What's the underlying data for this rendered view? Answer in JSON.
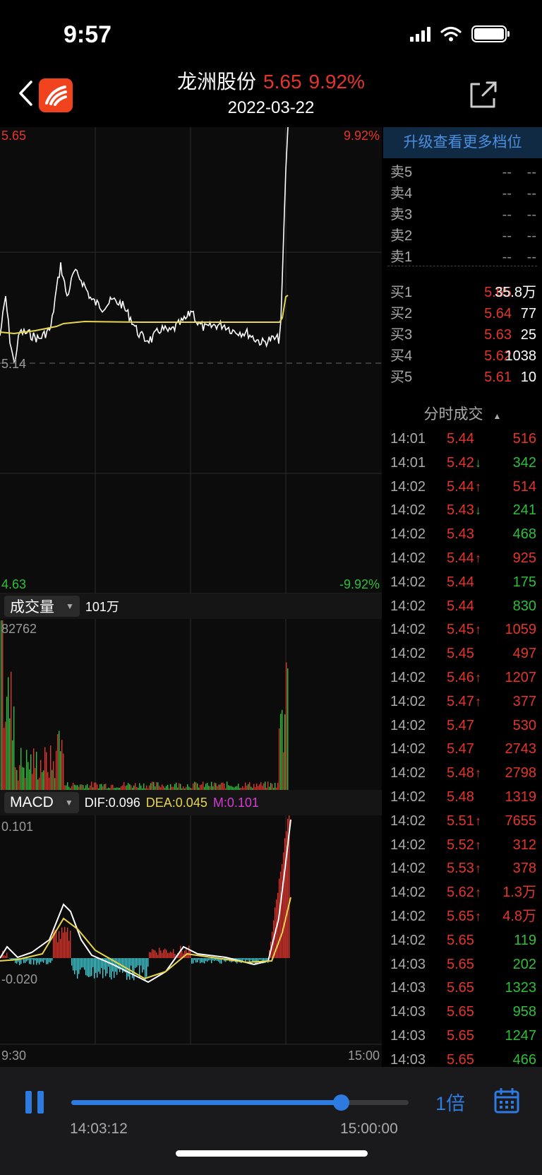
{
  "status_bar": {
    "time": "9:57"
  },
  "header": {
    "stock_name": "龙洲股份",
    "price": "5.65",
    "change_pct": "9.92%",
    "date": "2022-03-22"
  },
  "price_chart": {
    "high_price": "5.65",
    "high_pct": "9.92%",
    "low_price": "4.63",
    "low_pct": "-9.92%",
    "base_price": "5.14"
  },
  "volume_panel": {
    "indicator": "成交量",
    "total": "101万",
    "max_label": "82762"
  },
  "macd_panel": {
    "indicator": "MACD",
    "dif": "DIF:0.096",
    "dea": "DEA:0.045",
    "m": "M:0.101",
    "max_label": "0.101",
    "min_label": "-0.020",
    "time_start": "9:30",
    "time_end": "15:00"
  },
  "order_book": {
    "upgrade_label": "升级查看更多档位",
    "sells": [
      {
        "label": "卖5",
        "price": "--",
        "volume": "--"
      },
      {
        "label": "卖4",
        "price": "--",
        "volume": "--"
      },
      {
        "label": "卖3",
        "price": "--",
        "volume": "--"
      },
      {
        "label": "卖2",
        "price": "--",
        "volume": "--"
      },
      {
        "label": "卖1",
        "price": "--",
        "volume": "--"
      }
    ],
    "buys": [
      {
        "label": "买1",
        "price": "5.65",
        "volume": "35.8万"
      },
      {
        "label": "买2",
        "price": "5.64",
        "volume": "77"
      },
      {
        "label": "买3",
        "price": "5.63",
        "volume": "25"
      },
      {
        "label": "买4",
        "price": "5.62",
        "volume": "1038"
      },
      {
        "label": "买5",
        "price": "5.61",
        "volume": "10"
      }
    ]
  },
  "ticks": {
    "title": "分时成交",
    "rows": [
      {
        "time": "14:01",
        "price": "5.44",
        "arrow": "",
        "volume": "516",
        "color": "red"
      },
      {
        "time": "14:01",
        "price": "5.42",
        "arrow": "↓",
        "volume": "342",
        "color": "green"
      },
      {
        "time": "14:02",
        "price": "5.44",
        "arrow": "↑",
        "volume": "514",
        "color": "red"
      },
      {
        "time": "14:02",
        "price": "5.43",
        "arrow": "↓",
        "volume": "241",
        "color": "green"
      },
      {
        "time": "14:02",
        "price": "5.43",
        "arrow": "",
        "volume": "468",
        "color": "green"
      },
      {
        "time": "14:02",
        "price": "5.44",
        "arrow": "↑",
        "volume": "925",
        "color": "red"
      },
      {
        "time": "14:02",
        "price": "5.44",
        "arrow": "",
        "volume": "175",
        "color": "green"
      },
      {
        "time": "14:02",
        "price": "5.44",
        "arrow": "",
        "volume": "830",
        "color": "green"
      },
      {
        "time": "14:02",
        "price": "5.45",
        "arrow": "↑",
        "volume": "1059",
        "color": "red"
      },
      {
        "time": "14:02",
        "price": "5.45",
        "arrow": "",
        "volume": "497",
        "color": "red"
      },
      {
        "time": "14:02",
        "price": "5.46",
        "arrow": "↑",
        "volume": "1207",
        "color": "red"
      },
      {
        "time": "14:02",
        "price": "5.47",
        "arrow": "↑",
        "volume": "377",
        "color": "red"
      },
      {
        "time": "14:02",
        "price": "5.47",
        "arrow": "",
        "volume": "530",
        "color": "red"
      },
      {
        "time": "14:02",
        "price": "5.47",
        "arrow": "",
        "volume": "2743",
        "color": "red"
      },
      {
        "time": "14:02",
        "price": "5.48",
        "arrow": "↑",
        "volume": "2798",
        "color": "red"
      },
      {
        "time": "14:02",
        "price": "5.48",
        "arrow": "",
        "volume": "1319",
        "color": "red"
      },
      {
        "time": "14:02",
        "price": "5.51",
        "arrow": "↑",
        "volume": "7655",
        "color": "red"
      },
      {
        "time": "14:02",
        "price": "5.52",
        "arrow": "↑",
        "volume": "312",
        "color": "red"
      },
      {
        "time": "14:02",
        "price": "5.53",
        "arrow": "↑",
        "volume": "378",
        "color": "red"
      },
      {
        "time": "14:02",
        "price": "5.62",
        "arrow": "↑",
        "volume": "1.3万",
        "color": "red"
      },
      {
        "time": "14:02",
        "price": "5.65",
        "arrow": "↑",
        "volume": "4.8万",
        "color": "red"
      },
      {
        "time": "14:02",
        "price": "5.65",
        "arrow": "",
        "volume": "119",
        "color": "green"
      },
      {
        "time": "14:03",
        "price": "5.65",
        "arrow": "",
        "volume": "202",
        "color": "green"
      },
      {
        "time": "14:03",
        "price": "5.65",
        "arrow": "",
        "volume": "1323",
        "color": "green"
      },
      {
        "time": "14:03",
        "price": "5.65",
        "arrow": "",
        "volume": "958",
        "color": "green"
      },
      {
        "time": "14:03",
        "price": "5.65",
        "arrow": "",
        "volume": "1247",
        "color": "green"
      },
      {
        "time": "14:03",
        "price": "5.65",
        "arrow": "",
        "volume": "466",
        "color": "green"
      }
    ]
  },
  "playback": {
    "current_time": "14:03:12",
    "end_time": "15:00:00",
    "progress": 0.8,
    "speed_label": "1倍"
  },
  "colors": {
    "up": "#e4352c",
    "down": "#2fbf3b",
    "price_line": "#ffffff",
    "avg_line": "#e8d54a",
    "macd_negative": "#3fd0d8",
    "accent": "#2d7be0",
    "m_label": "#d63ad6"
  }
}
